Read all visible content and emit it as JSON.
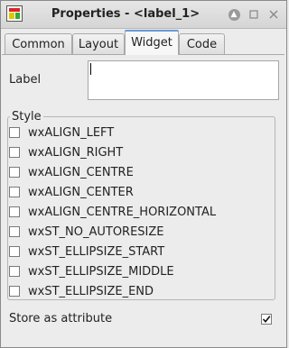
{
  "window": {
    "title": "Properties - <label_1>",
    "icon": "wxformbuilder-app-icon"
  },
  "tabs": [
    {
      "label": "Common",
      "active": false
    },
    {
      "label": "Layout",
      "active": false
    },
    {
      "label": "Widget",
      "active": true
    },
    {
      "label": "Code",
      "active": false
    }
  ],
  "label_field": {
    "caption": "Label",
    "value": ""
  },
  "style": {
    "title": "Style",
    "options": [
      {
        "label": "wxALIGN_LEFT",
        "checked": false
      },
      {
        "label": "wxALIGN_RIGHT",
        "checked": false
      },
      {
        "label": "wxALIGN_CENTRE",
        "checked": false
      },
      {
        "label": "wxALIGN_CENTER",
        "checked": false
      },
      {
        "label": "wxALIGN_CENTRE_HORIZONTAL",
        "checked": false
      },
      {
        "label": "wxST_NO_AUTORESIZE",
        "checked": false
      },
      {
        "label": "wxST_ELLIPSIZE_START",
        "checked": false
      },
      {
        "label": "wxST_ELLIPSIZE_MIDDLE",
        "checked": false
      },
      {
        "label": "wxST_ELLIPSIZE_END",
        "checked": false
      }
    ]
  },
  "store_as_attribute": {
    "label": "Store as attribute",
    "checked": true
  }
}
